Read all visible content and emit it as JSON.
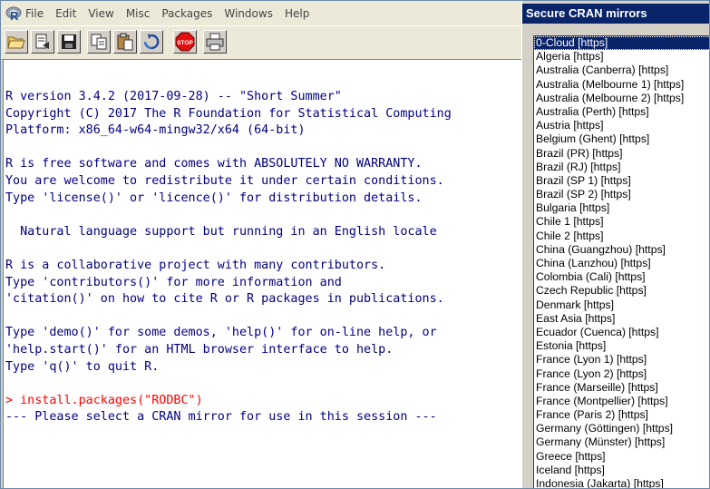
{
  "menu": {
    "logo_icon": "r-logo-icon",
    "items": [
      "File",
      "Edit",
      "View",
      "Misc",
      "Packages",
      "Windows",
      "Help"
    ]
  },
  "toolbar": {
    "buttons": [
      "open-script-icon",
      "load-workspace-icon",
      "save-icon",
      "copy-icon",
      "paste-icon",
      "copy-paste-icon",
      "stop-icon",
      "print-icon"
    ],
    "stop_label": "STOP"
  },
  "console": {
    "lines": [
      "R version 3.4.2 (2017-09-28) -- \"Short Summer\"",
      "Copyright (C) 2017 The R Foundation for Statistical Computing",
      "Platform: x86_64-w64-mingw32/x64 (64-bit)",
      "",
      "R is free software and comes with ABSOLUTELY NO WARRANTY.",
      "You are welcome to redistribute it under certain conditions.",
      "Type 'license()' or 'licence()' for distribution details.",
      "",
      "  Natural language support but running in an English locale",
      "",
      "R is a collaborative project with many contributors.",
      "Type 'contributors()' for more information and",
      "'citation()' on how to cite R or R packages in publications.",
      "",
      "Type 'demo()' for some demos, 'help()' for on-line help, or",
      "'help.start()' for an HTML browser interface to help.",
      "Type 'q()' to quit R.",
      ""
    ],
    "command": "> install.packages(\"RODBC\")",
    "status": "--- Please select a CRAN mirror for use in this session ---"
  },
  "mirrors": {
    "title": "Secure CRAN mirrors",
    "selected_index": 0,
    "items": [
      "0-Cloud [https]",
      "Algeria [https]",
      "Australia (Canberra) [https]",
      "Australia (Melbourne 1) [https]",
      "Australia (Melbourne 2) [https]",
      "Australia (Perth) [https]",
      "Austria [https]",
      "Belgium (Ghent) [https]",
      "Brazil (PR) [https]",
      "Brazil (RJ) [https]",
      "Brazil (SP 1) [https]",
      "Brazil (SP 2) [https]",
      "Bulgaria [https]",
      "Chile 1 [https]",
      "Chile 2 [https]",
      "China (Guangzhou) [https]",
      "China (Lanzhou) [https]",
      "Colombia (Cali) [https]",
      "Czech Republic [https]",
      "Denmark [https]",
      "East Asia [https]",
      "Ecuador (Cuenca) [https]",
      "Estonia [https]",
      "France (Lyon 1) [https]",
      "France (Lyon 2) [https]",
      "France (Marseille) [https]",
      "France (Montpellier) [https]",
      "France (Paris 2) [https]",
      "Germany (Göttingen) [https]",
      "Germany (Münster) [https]",
      "Greece [https]",
      "Iceland [https]",
      "Indonesia (Jakarta) [https]"
    ]
  }
}
